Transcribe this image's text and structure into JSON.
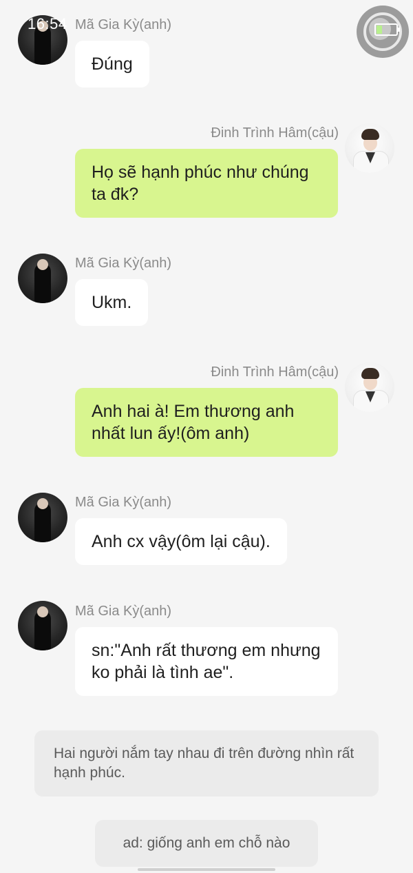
{
  "status": {
    "time": "16:54",
    "battery_icon": "battery-charging-icon"
  },
  "messages": [
    {
      "sender": "Mã Gia Kỳ(anh)",
      "text": "Đúng",
      "side": "left"
    },
    {
      "sender": "Đinh Trình Hâm(cậu)",
      "text": "Họ sẽ hạnh phúc như chúng ta đk?",
      "side": "right"
    },
    {
      "sender": "Mã Gia Kỳ(anh)",
      "text": "Ukm.",
      "side": "left"
    },
    {
      "sender": "Đinh Trình Hâm(cậu)",
      "text": "Anh hai à! Em thương anh nhất lun ấy!(ôm anh)",
      "side": "right"
    },
    {
      "sender": "Mã Gia Kỳ(anh)",
      "text": "Anh cx vậy(ôm lại cậu).",
      "side": "left"
    },
    {
      "sender": "Mã Gia Kỳ(anh)",
      "text": "sn:\"Anh rất thương em nhưng ko phải là tình ae\".",
      "side": "left"
    }
  ],
  "narration": "Hai người nắm tay nhau đi trên đường nhìn rất hạnh phúc.",
  "ad_note": "ad: giống anh em chỗ nào",
  "colors": {
    "background": "#f5f5f5",
    "bubble_self": "#d8f58f",
    "bubble_other": "#ffffff",
    "name_text": "#8a8a8a"
  }
}
